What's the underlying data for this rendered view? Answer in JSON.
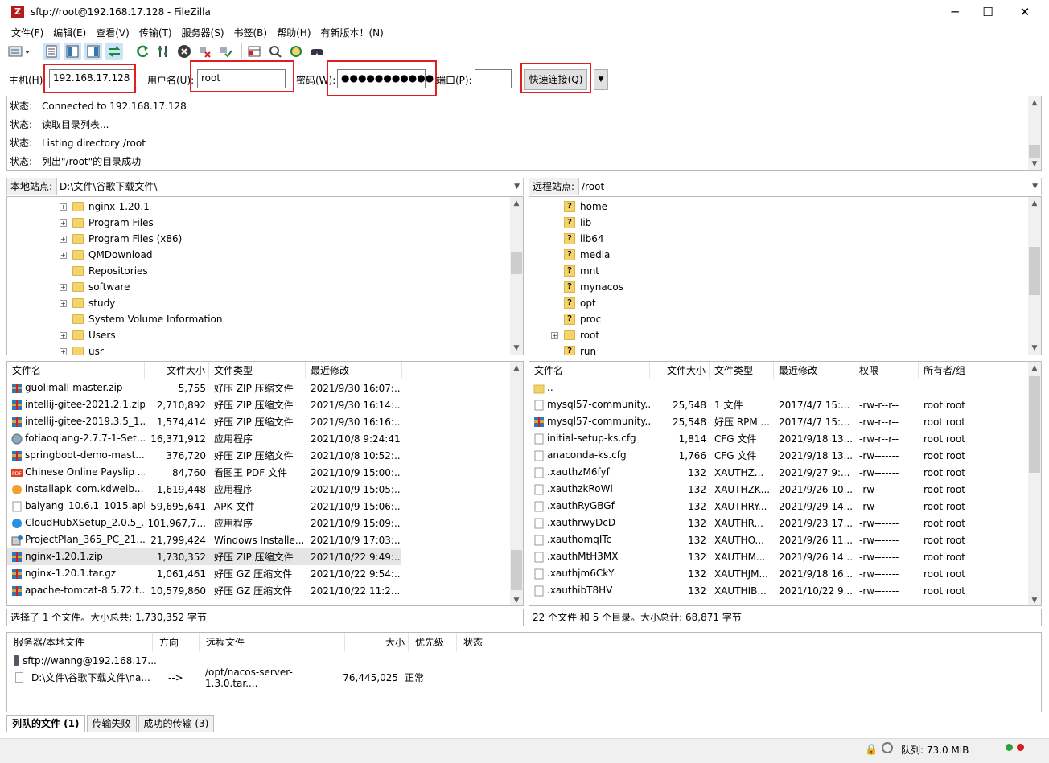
{
  "window": {
    "title": "sftp://root@192.168.17.128 - FileZilla",
    "minimize": "─",
    "maximize": "☐",
    "close": "✕"
  },
  "menu": [
    "文件(F)",
    "编辑(E)",
    "查看(V)",
    "传输(T)",
    "服务器(S)",
    "书签(B)",
    "帮助(H)",
    "有新版本！(N)"
  ],
  "toolbar_icons": [
    "site-manager-icon",
    "toggle-log-icon",
    "toggle-local-tree-icon",
    "toggle-remote-tree-icon",
    "toggle-queue-icon",
    "refresh-icon",
    "process-queue-icon",
    "cancel-icon",
    "disconnect-icon",
    "reconnect-icon",
    "filter-icon",
    "toggle-compare-icon",
    "sync-browse-icon",
    "search-icon"
  ],
  "quickconnect": {
    "host_label": "主机(H):",
    "host_value": "192.168.17.128",
    "user_label": "用户名(U):",
    "user_value": "root",
    "pass_label": "密码(W):",
    "pass_value": "●●●●●●●●●●●",
    "port_label": "端口(P):",
    "port_value": "",
    "button": "快速连接(Q)",
    "dropdown": "▼"
  },
  "log": [
    {
      "k": "状态:",
      "v": "Connected to 192.168.17.128"
    },
    {
      "k": "状态:",
      "v": "读取目录列表..."
    },
    {
      "k": "状态:",
      "v": "Listing directory /root"
    },
    {
      "k": "状态:",
      "v": "列出\"/root\"的目录成功"
    }
  ],
  "local": {
    "site_label": "本地站点:",
    "path": "D:\\文件\\谷歌下载文件\\",
    "tree": [
      {
        "name": "nginx-1.20.1",
        "exp": true
      },
      {
        "name": "Program Files",
        "exp": true
      },
      {
        "name": "Program Files (x86)",
        "exp": true
      },
      {
        "name": "QMDownload",
        "exp": true
      },
      {
        "name": "Repositories",
        "exp": false
      },
      {
        "name": "software",
        "exp": true
      },
      {
        "name": "study",
        "exp": true
      },
      {
        "name": "System Volume Information",
        "exp": false
      },
      {
        "name": "Users",
        "exp": true
      },
      {
        "name": "usr",
        "exp": true
      }
    ],
    "headers": [
      "文件名",
      "文件大小",
      "文件类型",
      "最近修改"
    ],
    "files": [
      {
        "name": "guolimall-master.zip",
        "size": "5,755",
        "type": "好压 ZIP 压缩文件",
        "mod": "2021/9/30 16:07:...",
        "icon": "zip"
      },
      {
        "name": "intellij-gitee-2021.2.1.zip",
        "size": "2,710,892",
        "type": "好压 ZIP 压缩文件",
        "mod": "2021/9/30 16:14:...",
        "icon": "zip"
      },
      {
        "name": "intellij-gitee-2019.3.5_1....",
        "size": "1,574,414",
        "type": "好压 ZIP 压缩文件",
        "mod": "2021/9/30 16:16:...",
        "icon": "zip"
      },
      {
        "name": "fotiaoqiang-2.7.7-1-Set...",
        "size": "16,371,912",
        "type": "应用程序",
        "mod": "2021/10/8 9:24:41",
        "icon": "exe"
      },
      {
        "name": "springboot-demo-mast...",
        "size": "376,720",
        "type": "好压 ZIP 压缩文件",
        "mod": "2021/10/8 10:52:...",
        "icon": "zip"
      },
      {
        "name": "Chinese Online Payslip ...",
        "size": "84,760",
        "type": "看图王 PDF 文件",
        "mod": "2021/10/9 15:00:...",
        "icon": "pdf"
      },
      {
        "name": "installapk_com.kdweib...",
        "size": "1,619,448",
        "type": "应用程序",
        "mod": "2021/10/9 15:05:...",
        "icon": "exe2"
      },
      {
        "name": "baiyang_10.6.1_1015.apk",
        "size": "59,695,641",
        "type": "APK 文件",
        "mod": "2021/10/9 15:06:...",
        "icon": "file"
      },
      {
        "name": "CloudHubXSetup_2.0.5_...",
        "size": "101,967,7...",
        "type": "应用程序",
        "mod": "2021/10/9 15:09:...",
        "icon": "cloud"
      },
      {
        "name": "ProjectPlan_365_PC_21....",
        "size": "21,799,424",
        "type": "Windows Installe...",
        "mod": "2021/10/9 17:03:...",
        "icon": "msi"
      },
      {
        "name": "nginx-1.20.1.zip",
        "size": "1,730,352",
        "type": "好压 ZIP 压缩文件",
        "mod": "2021/10/22 9:49:...",
        "icon": "zip",
        "sel": true
      },
      {
        "name": "nginx-1.20.1.tar.gz",
        "size": "1,061,461",
        "type": "好压 GZ 压缩文件",
        "mod": "2021/10/22 9:54:...",
        "icon": "zip"
      },
      {
        "name": "apache-tomcat-8.5.72.t...",
        "size": "10,579,860",
        "type": "好压 GZ 压缩文件",
        "mod": "2021/10/22 11:2...",
        "icon": "zip"
      }
    ],
    "status": "选择了 1 个文件。大小总共: 1,730,352 字节"
  },
  "remote": {
    "site_label": "远程站点:",
    "path": "/root",
    "tree": [
      {
        "name": "home",
        "exp": false
      },
      {
        "name": "lib",
        "exp": false
      },
      {
        "name": "lib64",
        "exp": false
      },
      {
        "name": "media",
        "exp": false
      },
      {
        "name": "mnt",
        "exp": false
      },
      {
        "name": "mynacos",
        "exp": false
      },
      {
        "name": "opt",
        "exp": false
      },
      {
        "name": "proc",
        "exp": false
      },
      {
        "name": "root",
        "exp": true,
        "plain": true
      },
      {
        "name": "run",
        "exp": false
      }
    ],
    "headers": [
      "文件名",
      "文件大小",
      "文件类型",
      "最近修改",
      "权限",
      "所有者/组"
    ],
    "files": [
      {
        "name": "..",
        "size": "",
        "type": "",
        "mod": "",
        "perm": "",
        "owner": "",
        "icon": "folder"
      },
      {
        "name": "mysql57-community...",
        "size": "25,548",
        "type": "1 文件",
        "mod": "2017/4/7 15:...",
        "perm": "-rw-r--r--",
        "owner": "root root",
        "icon": "file"
      },
      {
        "name": "mysql57-community...",
        "size": "25,548",
        "type": "好压 RPM ...",
        "mod": "2017/4/7 15:...",
        "perm": "-rw-r--r--",
        "owner": "root root",
        "icon": "zip"
      },
      {
        "name": "initial-setup-ks.cfg",
        "size": "1,814",
        "type": "CFG 文件",
        "mod": "2021/9/18 13...",
        "perm": "-rw-r--r--",
        "owner": "root root",
        "icon": "file"
      },
      {
        "name": "anaconda-ks.cfg",
        "size": "1,766",
        "type": "CFG 文件",
        "mod": "2021/9/18 13...",
        "perm": "-rw-------",
        "owner": "root root",
        "icon": "file"
      },
      {
        "name": ".xauthzM6fyf",
        "size": "132",
        "type": "XAUTHZ...",
        "mod": "2021/9/27 9:...",
        "perm": "-rw-------",
        "owner": "root root",
        "icon": "file"
      },
      {
        "name": ".xauthzkRoWl",
        "size": "132",
        "type": "XAUTHZK...",
        "mod": "2021/9/26 10...",
        "perm": "-rw-------",
        "owner": "root root",
        "icon": "file"
      },
      {
        "name": ".xauthRyGBGf",
        "size": "132",
        "type": "XAUTHRY...",
        "mod": "2021/9/29 14...",
        "perm": "-rw-------",
        "owner": "root root",
        "icon": "file"
      },
      {
        "name": ".xauthrwyDcD",
        "size": "132",
        "type": "XAUTHR...",
        "mod": "2021/9/23 17...",
        "perm": "-rw-------",
        "owner": "root root",
        "icon": "file"
      },
      {
        "name": ".xauthomqITc",
        "size": "132",
        "type": "XAUTHO...",
        "mod": "2021/9/26 11...",
        "perm": "-rw-------",
        "owner": "root root",
        "icon": "file"
      },
      {
        "name": ".xauthMtH3MX",
        "size": "132",
        "type": "XAUTHM...",
        "mod": "2021/9/26 14...",
        "perm": "-rw-------",
        "owner": "root root",
        "icon": "file"
      },
      {
        "name": ".xauthjm6CkY",
        "size": "132",
        "type": "XAUTHJM...",
        "mod": "2021/9/18 16...",
        "perm": "-rw-------",
        "owner": "root root",
        "icon": "file"
      },
      {
        "name": ".xauthibT8HV",
        "size": "132",
        "type": "XAUTHIB...",
        "mod": "2021/10/22 9...",
        "perm": "-rw-------",
        "owner": "root root",
        "icon": "file"
      }
    ],
    "status": "22 个文件 和 5 个目录。大小总计: 68,871 字节"
  },
  "queue": {
    "headers": [
      "服务器/本地文件",
      "方向",
      "远程文件",
      "大小",
      "优先级",
      "状态"
    ],
    "server": "sftp://wanng@192.168.17...",
    "item": {
      "local": "D:\\文件\\谷歌下载文件\\na...",
      "dir": "-->",
      "remote": "/opt/nacos-server-1.3.0.tar....",
      "size": "76,445,025",
      "priority": "正常",
      "status": ""
    }
  },
  "tabs": [
    "列队的文件 (1)",
    "传输失败",
    "成功的传输 (3)"
  ],
  "statusbar": {
    "queue": "队列: 73.0 MiB"
  },
  "colors": {
    "highlight": "#e02020",
    "selected_row": "#e5e5e5",
    "folder": "#f5d36b"
  }
}
